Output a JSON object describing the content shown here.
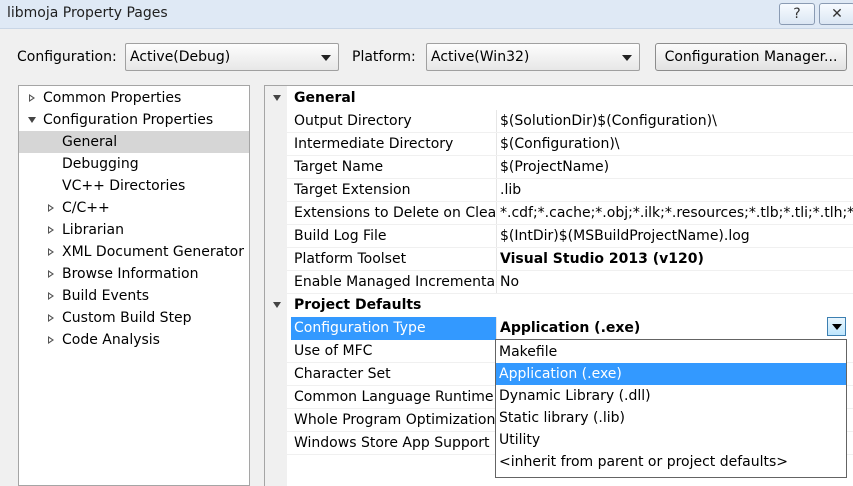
{
  "window": {
    "title": "libmoja Property Pages",
    "help_label": "?",
    "close_label": "✕"
  },
  "config_bar": {
    "configuration_label": "Configuration:",
    "configuration_value": "Active(Debug)",
    "platform_label": "Platform:",
    "platform_value": "Active(Win32)",
    "manager_button": "Configuration Manager..."
  },
  "tree": {
    "common_properties": "Common Properties",
    "configuration_properties": "Configuration Properties",
    "general": "General",
    "debugging": "Debugging",
    "vc_directories": "VC++ Directories",
    "c_cpp": "C/C++",
    "librarian": "Librarian",
    "xml_doc": "XML Document Generator",
    "browse_info": "Browse Information",
    "build_events": "Build Events",
    "custom_build": "Custom Build Step",
    "code_analysis": "Code Analysis"
  },
  "grid": {
    "general_header": "General",
    "output_dir": {
      "name": "Output Directory",
      "value": "$(SolutionDir)$(Configuration)\\"
    },
    "intermediate_dir": {
      "name": "Intermediate Directory",
      "value": "$(Configuration)\\"
    },
    "target_name": {
      "name": "Target Name",
      "value": "$(ProjectName)"
    },
    "target_ext": {
      "name": "Target Extension",
      "value": ".lib"
    },
    "ext_delete": {
      "name": "Extensions to Delete on Clean",
      "value": "*.cdf;*.cache;*.obj;*.ilk;*.resources;*.tlb;*.tli;*.tlh;*.tmp;*"
    },
    "build_log": {
      "name": "Build Log File",
      "value": "$(IntDir)$(MSBuildProjectName).log"
    },
    "platform_toolset": {
      "name": "Platform Toolset",
      "value": "Visual Studio 2013 (v120)"
    },
    "managed_incremental": {
      "name": "Enable Managed Incremental Build",
      "value": "No"
    },
    "project_defaults_header": "Project Defaults",
    "config_type": {
      "name": "Configuration Type",
      "value": "Application (.exe)"
    },
    "use_mfc": {
      "name": "Use of MFC"
    },
    "char_set": {
      "name": "Character Set"
    },
    "clr_support": {
      "name": "Common Language Runtime Support"
    },
    "wpo": {
      "name": "Whole Program Optimization"
    },
    "store_app": {
      "name": "Windows Store App Support"
    }
  },
  "dropdown": {
    "options": [
      "Makefile",
      "Application (.exe)",
      "Dynamic Library (.dll)",
      "Static library (.lib)",
      "Utility",
      "<inherit from parent or project defaults>"
    ]
  }
}
